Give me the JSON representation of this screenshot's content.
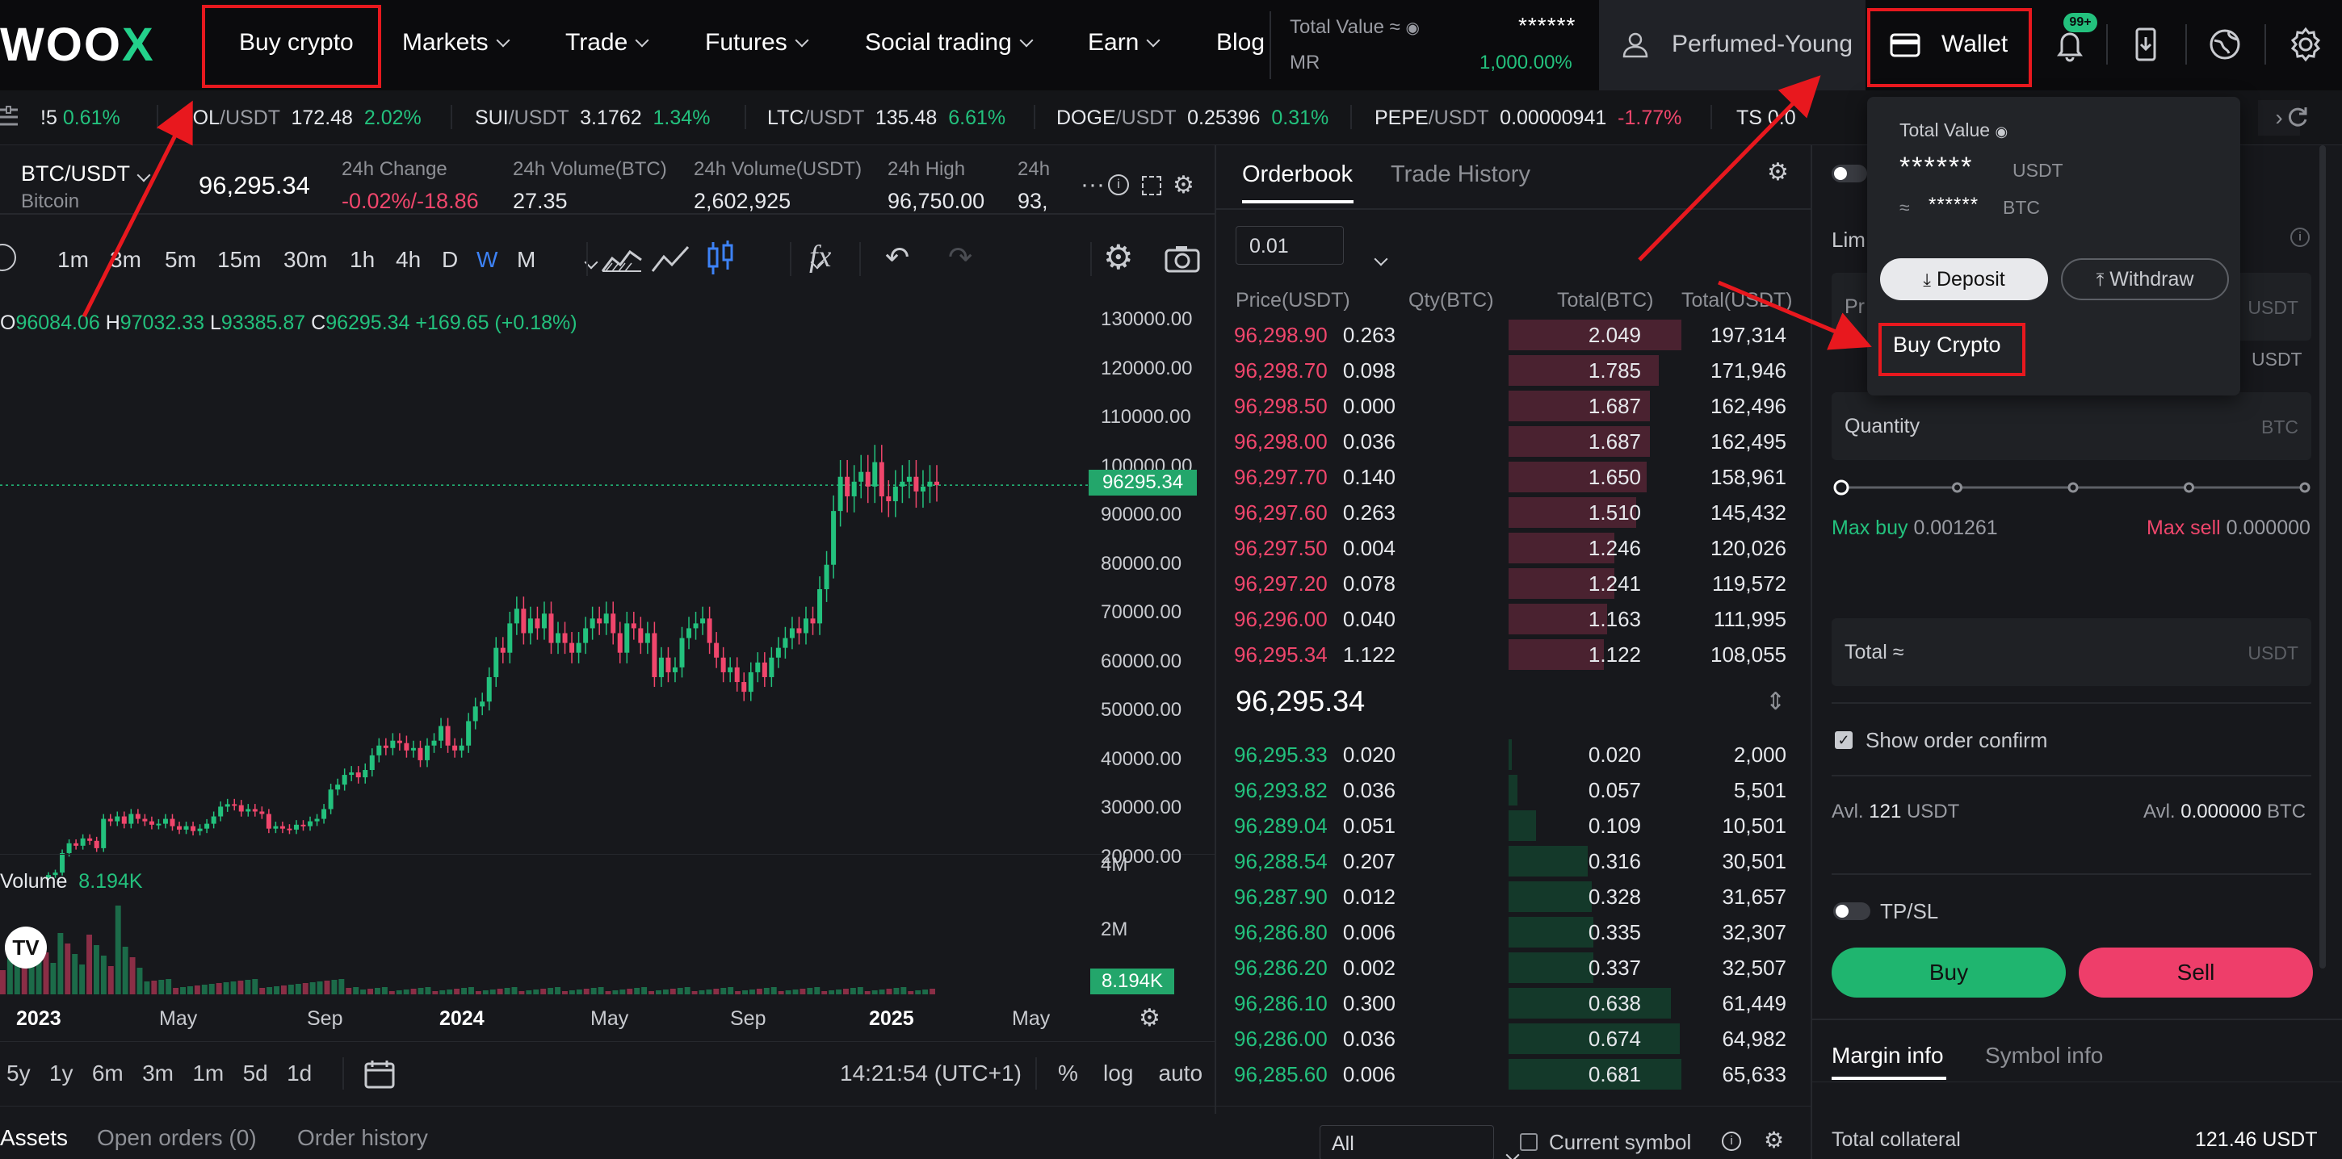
{
  "nav": {
    "logo_main": "WOO",
    "logo_x": "X",
    "items": [
      {
        "label": "Buy crypto"
      },
      {
        "label": "Markets"
      },
      {
        "label": "Trade"
      },
      {
        "label": "Futures"
      },
      {
        "label": "Social trading"
      },
      {
        "label": "Earn"
      },
      {
        "label": "Blog"
      }
    ],
    "total_value_label": "Total Value ≈",
    "total_value": "******",
    "mr_label": "MR",
    "mr_value": "1,000.00%",
    "username": "Perfumed-Young",
    "wallet": "Wallet",
    "notif_badge": "99+"
  },
  "ticker": [
    {
      "sym": "!5",
      "quote": "",
      "price": "",
      "chg": "0.61%",
      "dir": "up"
    },
    {
      "sym": "SOL",
      "quote": "/USDT",
      "price": "172.48",
      "chg": "2.02%",
      "dir": "up"
    },
    {
      "sym": "SUI",
      "quote": "/USDT",
      "price": "3.1762",
      "chg": "1.34%",
      "dir": "up"
    },
    {
      "sym": "LTC",
      "quote": "/USDT",
      "price": "135.48",
      "chg": "6.61%",
      "dir": "up"
    },
    {
      "sym": "DOGE",
      "quote": "/USDT",
      "price": "0.25396",
      "chg": "0.31%",
      "dir": "up"
    },
    {
      "sym": "PEPE",
      "quote": "/USDT",
      "price": "0.00000941",
      "chg": "-1.77%",
      "dir": "down"
    },
    {
      "sym": "TS",
      "quote": "",
      "price": "0.0",
      "chg": "",
      "dir": "up"
    }
  ],
  "symbol": {
    "pair": "BTC/USDT",
    "name": "Bitcoin",
    "last": "96,295.34",
    "stats": [
      {
        "label": "24h Change",
        "value": "-0.02%/-18.86",
        "dir": "down"
      },
      {
        "label": "24h Volume(BTC)",
        "value": "27.35",
        "dir": "none"
      },
      {
        "label": "24h Volume(USDT)",
        "value": "2,602,925",
        "dir": "none"
      },
      {
        "label": "24h High",
        "value": "96,750.00",
        "dir": "none"
      },
      {
        "label": "24h",
        "value": "93,",
        "dir": "none"
      }
    ]
  },
  "chart": {
    "timeframes": [
      "1m",
      "3m",
      "5m",
      "15m",
      "30m",
      "1h",
      "4h",
      "D",
      "W",
      "M"
    ],
    "active_timeframe": "W",
    "ohlc": {
      "o_label": "O",
      "o": "96084.06",
      "h_label": "H",
      "h": "97032.33",
      "l_label": "L",
      "l": "93385.87",
      "c_label": "C",
      "c": "96295.34",
      "change": "+169.65 (+0.18%)"
    },
    "price_axis": [
      "130000.00",
      "120000.00",
      "110000.00",
      "100000.00",
      "90000.00",
      "80000.00",
      "70000.00",
      "60000.00",
      "50000.00",
      "40000.00",
      "30000.00",
      "20000.00"
    ],
    "last_price_tag": "96295.34",
    "volume_label": "Volume",
    "volume_value": "8.194K",
    "volume_axis": [
      "4M",
      "2M"
    ],
    "volume_tag": "8.194K",
    "time_axis": [
      "2023",
      "May",
      "Sep",
      "2024",
      "May",
      "Sep",
      "2025",
      "May"
    ],
    "ranges": [
      "5y",
      "1y",
      "6m",
      "3m",
      "1m",
      "5d",
      "1d"
    ],
    "clock": "14:21:54 (UTC+1)",
    "scale_opts": [
      "%",
      "log",
      "auto"
    ],
    "tv_logo": "TV"
  },
  "chart_data": {
    "type": "candlestick",
    "title": "BTC/USDT",
    "x": "weekly candles, Jan 2023 – Feb 2025",
    "ylim": [
      20000,
      130000
    ],
    "series": [
      {
        "name": "BTC/USDT",
        "values": [
          16500,
          17000,
          21000,
          23000,
          22500,
          24000,
          23500,
          22000,
          28000,
          27500,
          28500,
          27000,
          29000,
          28000,
          27500,
          26800,
          27000,
          28000,
          26500,
          25800,
          26500,
          25500,
          26000,
          27000,
          28500,
          30500,
          31000,
          30800,
          29500,
          30000,
          29500,
          29000,
          26000,
          26500,
          26000,
          25800,
          26800,
          26500,
          27500,
          28000,
          30000,
          34000,
          35000,
          37000,
          37500,
          36500,
          38000,
          41000,
          43000,
          42500,
          44000,
          43500,
          42000,
          42500,
          40000,
          43000,
          44000,
          47000,
          43000,
          42000,
          43000,
          48000,
          51000,
          52000,
          57000,
          63000,
          62000,
          68000,
          71000,
          66000,
          69000,
          67000,
          70000,
          64000,
          66000,
          64000,
          62000,
          64000,
          67000,
          69000,
          68000,
          70000,
          66000,
          62000,
          68000,
          67000,
          64000,
          66000,
          57000,
          61000,
          58000,
          59000,
          65000,
          67000,
          68000,
          69000,
          64000,
          61000,
          58000,
          59000,
          56000,
          54000,
          58000,
          60000,
          57000,
          61000,
          63000,
          65000,
          67000,
          66000,
          69000,
          68000,
          75000,
          80000,
          91000,
          98000,
          94000,
          97000,
          99000,
          96000,
          101000,
          94000,
          93000,
          96000,
          97000,
          98000,
          95000,
          96000,
          97000,
          96295
        ]
      }
    ]
  },
  "orderbook": {
    "tabs": [
      "Orderbook",
      "Trade History"
    ],
    "active_tab": "Orderbook",
    "precision": "0.01",
    "headers": [
      "Price(USDT)",
      "Qty(BTC)",
      "Total(BTC)",
      "Total(USDT)"
    ],
    "asks": [
      [
        "96,298.90",
        "0.263",
        "2.049",
        "197,314"
      ],
      [
        "96,298.70",
        "0.098",
        "1.785",
        "171,946"
      ],
      [
        "96,298.50",
        "0.000",
        "1.687",
        "162,496"
      ],
      [
        "96,298.00",
        "0.036",
        "1.687",
        "162,495"
      ],
      [
        "96,297.70",
        "0.140",
        "1.650",
        "158,961"
      ],
      [
        "96,297.60",
        "0.263",
        "1.510",
        "145,432"
      ],
      [
        "96,297.50",
        "0.004",
        "1.246",
        "120,026"
      ],
      [
        "96,297.20",
        "0.078",
        "1.241",
        "119,572"
      ],
      [
        "96,296.00",
        "0.040",
        "1.163",
        "111,995"
      ],
      [
        "96,295.34",
        "1.122",
        "1.122",
        "108,055"
      ]
    ],
    "ask_depth": [
      1.0,
      0.87,
      0.82,
      0.82,
      0.8,
      0.74,
      0.61,
      0.61,
      0.57,
      0.55
    ],
    "mid_price": "96,295.34",
    "bids": [
      [
        "96,295.33",
        "0.020",
        "0.020",
        "2,000"
      ],
      [
        "96,293.82",
        "0.036",
        "0.057",
        "5,501"
      ],
      [
        "96,289.04",
        "0.051",
        "0.109",
        "10,501"
      ],
      [
        "96,288.54",
        "0.207",
        "0.316",
        "30,501"
      ],
      [
        "96,287.90",
        "0.012",
        "0.328",
        "31,657"
      ],
      [
        "96,286.80",
        "0.006",
        "0.335",
        "32,307"
      ],
      [
        "96,286.20",
        "0.002",
        "0.337",
        "32,507"
      ],
      [
        "96,286.10",
        "0.300",
        "0.638",
        "61,449"
      ],
      [
        "96,286.00",
        "0.036",
        "0.674",
        "64,982"
      ],
      [
        "96,285.60",
        "0.006",
        "0.681",
        "65,633"
      ]
    ],
    "bid_depth": [
      0.02,
      0.05,
      0.16,
      0.46,
      0.48,
      0.49,
      0.49,
      0.94,
      0.99,
      1.0
    ]
  },
  "wallet_dropdown": {
    "total_label": "Total Value",
    "total_value": "******",
    "total_unit": "USDT",
    "approx": "≈",
    "btc_value": "******",
    "btc_unit": "BTC",
    "deposit": "Deposit",
    "withdraw": "Withdraw",
    "buy_crypto": "Buy Crypto"
  },
  "order_form": {
    "order_type": "Lim",
    "price_label": "Pr",
    "price_unit": "USDT",
    "unit2": "USDT",
    "qty_label": "Quantity",
    "qty_unit": "BTC",
    "slider_level": 0,
    "max_buy_label": "Max buy",
    "max_buy": "0.001261",
    "max_sell_label": "Max sell",
    "max_sell": "0.000000",
    "total_label": "Total ≈",
    "total_unit": "USDT",
    "show_confirm": "Show order confirm",
    "avl1_label": "Avl.",
    "avl1_val": "121",
    "avl1_unit": "USDT",
    "avl2_label": "Avl.",
    "avl2_val": "0.000000",
    "avl2_unit": "BTC",
    "tpsl": "TP/SL",
    "buy": "Buy",
    "sell": "Sell",
    "info_tabs": [
      "Margin info",
      "Symbol info"
    ],
    "collateral_label": "Total collateral",
    "collateral_value": "121.46 USDT"
  },
  "bottom": {
    "tabs": [
      "Assets",
      "Open orders (0)",
      "Order history"
    ],
    "filter": "All",
    "current_symbol": "Current symbol"
  },
  "colors": {
    "up": "#23c17d",
    "down": "#f0466c",
    "accent": "#23d18b",
    "highlight": "#e8181e",
    "bg": "#17181c"
  }
}
